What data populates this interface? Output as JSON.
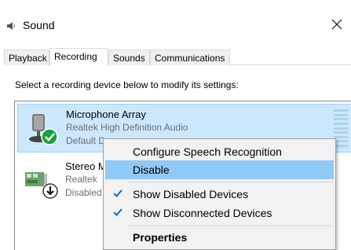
{
  "window": {
    "title": "Sound"
  },
  "tabs": [
    {
      "label": "Playback"
    },
    {
      "label": "Recording"
    },
    {
      "label": "Sounds"
    },
    {
      "label": "Communications"
    }
  ],
  "active_tab": "Recording",
  "instructions": "Select a recording device below to modify its settings:",
  "devices": [
    {
      "name": "Microphone Array",
      "driver": "Realtek High Definition Audio",
      "status": "Default D",
      "selected": true,
      "badge": "green-check-icon"
    },
    {
      "name": "Stereo M",
      "driver": "Realtek",
      "status": "Disabled",
      "selected": false,
      "badge": "down-arrow-icon"
    }
  ],
  "context_menu": {
    "items": [
      {
        "label": "Configure Speech Recognition",
        "checked": false
      },
      {
        "label": "Disable",
        "checked": false,
        "highlighted": true
      },
      {
        "label": "Show Disabled Devices",
        "checked": true
      },
      {
        "label": "Show Disconnected Devices",
        "checked": true
      },
      {
        "label": "Properties",
        "bold": true
      }
    ]
  },
  "colors": {
    "selection": "#cce8ff",
    "menu_highlight": "#91c9f7",
    "check": "#0063b1",
    "default_badge": "#17a33b"
  }
}
